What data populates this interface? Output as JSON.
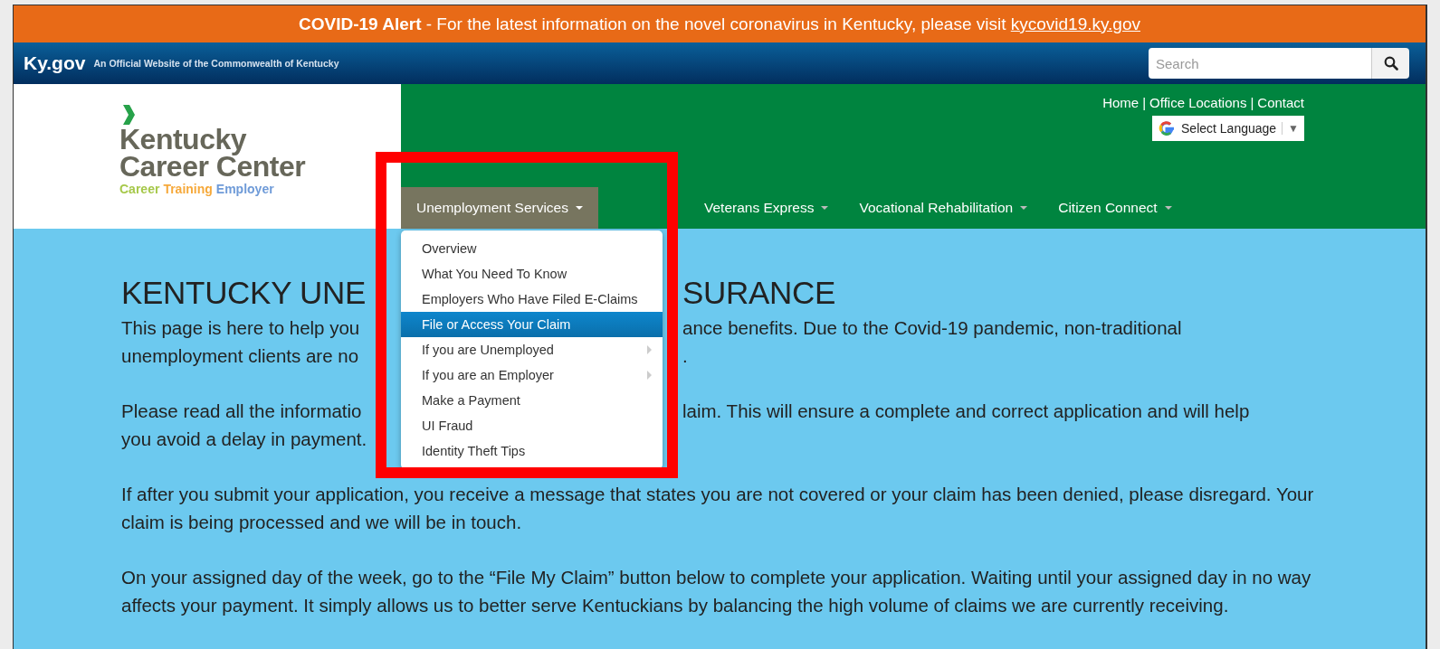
{
  "alert": {
    "text": "**COVID-19 Alert** - For the latest information on the novel coronavirus in Kentucky, please visit ",
    "link": "kycovid19.ky.gov"
  },
  "gov_bar": {
    "logo": "Ky.gov",
    "tagline": "An Official Website of the Commonwealth of Kentucky",
    "search": {
      "placeholder": "Search"
    }
  },
  "header": {
    "logo": {
      "lines": [
        "Kentucky",
        "Career Center"
      ],
      "taglines": [
        {
          "text": "Career",
          "color": "#a6c84a"
        },
        {
          "text": "Training",
          "color": "#f6a93b"
        },
        {
          "text": "Employer",
          "color": "#6f9bd8"
        }
      ]
    },
    "utility_links": [
      "Home",
      "Office Locations",
      "Contact"
    ],
    "separator": "|",
    "language": {
      "label": "Select Language",
      "caret": "▼"
    }
  },
  "nav": [
    {
      "label": "Unemployment Services",
      "selected": true
    },
    {
      "label": "Veterans Express",
      "selected": false
    },
    {
      "label": "Vocational Rehabilitation",
      "selected": false
    },
    {
      "label": "Citizen Connect",
      "selected": false
    }
  ],
  "menu": [
    {
      "label": "Overview",
      "selected": false,
      "submenu": false
    },
    {
      "label": "What You Need To Know",
      "selected": false,
      "submenu": false
    },
    {
      "label": "Employers Who Have Filed E-Claims",
      "selected": false,
      "submenu": false
    },
    {
      "label": "File or Access Your Claim",
      "selected": true,
      "submenu": false
    },
    {
      "label": "If you are Unemployed",
      "selected": false,
      "submenu": true
    },
    {
      "label": "If you are an Employer",
      "selected": false,
      "submenu": true
    },
    {
      "label": "Make a Payment",
      "selected": false,
      "submenu": false
    },
    {
      "label": "UI Fraud",
      "selected": false,
      "submenu": false
    },
    {
      "label": "Identity Theft Tips",
      "selected": false,
      "submenu": false
    }
  ],
  "content": {
    "heading": {
      "left": "KENTUCKY UNE",
      "right": "SURANCE"
    },
    "paragraphs": [
      {
        "kind": "split",
        "lines": [
          {
            "left": "This page is here to help you",
            "right": "ance benefits. Due to the Covid-19 pandemic, non-traditional"
          },
          {
            "left": "unemployment clients are no",
            "right": "."
          }
        ]
      },
      {
        "kind": "split",
        "lines": [
          {
            "left": "Please read all the informatio",
            "right": "laim. This will ensure a complete and correct application and will help"
          },
          {
            "left": "you avoid a delay in payment."
          }
        ]
      },
      {
        "kind": "text",
        "text": "If after you submit your application, you receive a message that states you are not covered or your claim has been denied, please disregard. Your claim is being processed and we will be in touch."
      },
      {
        "kind": "text",
        "text": "On your assigned day of the week, go to the “File My Claim” button below to complete your application. Waiting until your assigned day in no way affects your payment. It simply allows us to better serve Kentuckians by balancing the high volume of claims we are currently receiving."
      }
    ]
  }
}
